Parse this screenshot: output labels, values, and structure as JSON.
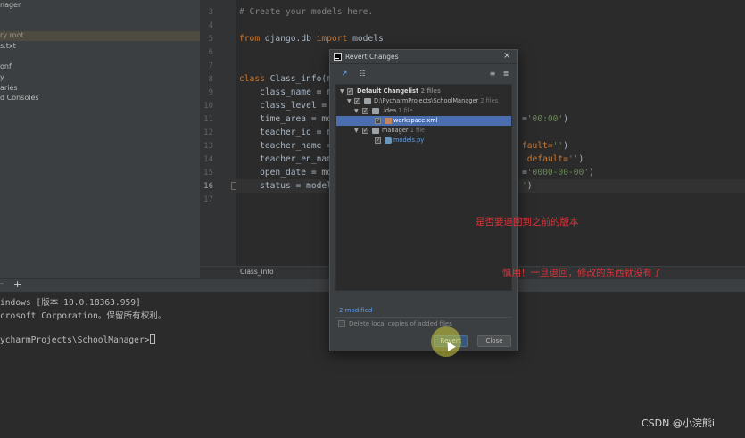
{
  "sidebar": {
    "items": [
      "nager",
      "",
      "ry root",
      "s.txt",
      "",
      "onf",
      "y",
      "aries",
      "d Consoles"
    ]
  },
  "editor": {
    "line_numbers": [
      "3",
      "4",
      "5",
      "6",
      "7",
      "8",
      "9",
      "10",
      "11",
      "12",
      "13",
      "14",
      "15",
      "16",
      "17"
    ],
    "code": {
      "l3": "# Create your models here.",
      "l5_kw1": "from",
      "l5_mod": " django.db ",
      "l5_kw2": "import",
      "l5_rest": " models",
      "l8_kw": "class",
      "l8_rest": " Class_info(m",
      "l9": "    class_name = m",
      "l10": "    class_level = ",
      "l11": "    time_area = mo",
      "l11_tail_a": "=",
      "l11_tail_str": "'00:00'",
      "l11_tail_b": ")",
      "l12": "    teacher_id = m",
      "l13": "    teacher_name =",
      "l13_tail_a": "fault=",
      "l13_tail_str": "''",
      "l13_tail_b": ")",
      "l14": "    teacher_en_nam",
      "l14_tail_a": " default=",
      "l14_tail_str": "''",
      "l14_tail_b": ")",
      "l15": "    open_date = mo",
      "l15_tail_a": "=",
      "l15_tail_str": "'0000-00-00'",
      "l15_tail_b": ")",
      "l16": "    status = model",
      "l16_tail_str": "'",
      "l16_tail_b": ")"
    },
    "breadcrumb": "Class_info"
  },
  "terminal": {
    "close_tab": "–",
    "add_tab": "+",
    "lines": [
      "indows [版本 10.0.18363.959]",
      "crosoft Corporation。保留所有权利。",
      "",
      "ycharmProjects\\SchoolManager>"
    ]
  },
  "dialog": {
    "title": "Revert Changes",
    "close_icon": "×",
    "toolbar": {
      "group_icon": "↗",
      "tree_icon": "☷",
      "expand_icon": "≡",
      "collapse_icon": "≣"
    },
    "tree": [
      {
        "label": "Default Changelist",
        "count": "2 files"
      },
      {
        "label": "D:\\PycharmProjects\\SchoolManager",
        "count": "2 files"
      },
      {
        "label": ".idea",
        "count": "1 file"
      },
      {
        "label": "workspace.xml",
        "count": ""
      },
      {
        "label": "manager",
        "count": "1 file"
      },
      {
        "label": "models.py",
        "count": ""
      }
    ],
    "status": "2 modified",
    "delete_checkbox_label": "Delete local copies of added files",
    "revert_label": "Revert",
    "close_label": "Close"
  },
  "annotations": {
    "note1": "是否要退回到之前的版本",
    "note2": "慎用！一旦退回，修改的东西就没有了"
  },
  "watermark": "CSDN @小浣熊i",
  "colors": {
    "keyword": "#cc7832",
    "string": "#6a8759",
    "comment": "#808080",
    "selection": "#4b6eaf",
    "annotation": "#e0323a"
  }
}
